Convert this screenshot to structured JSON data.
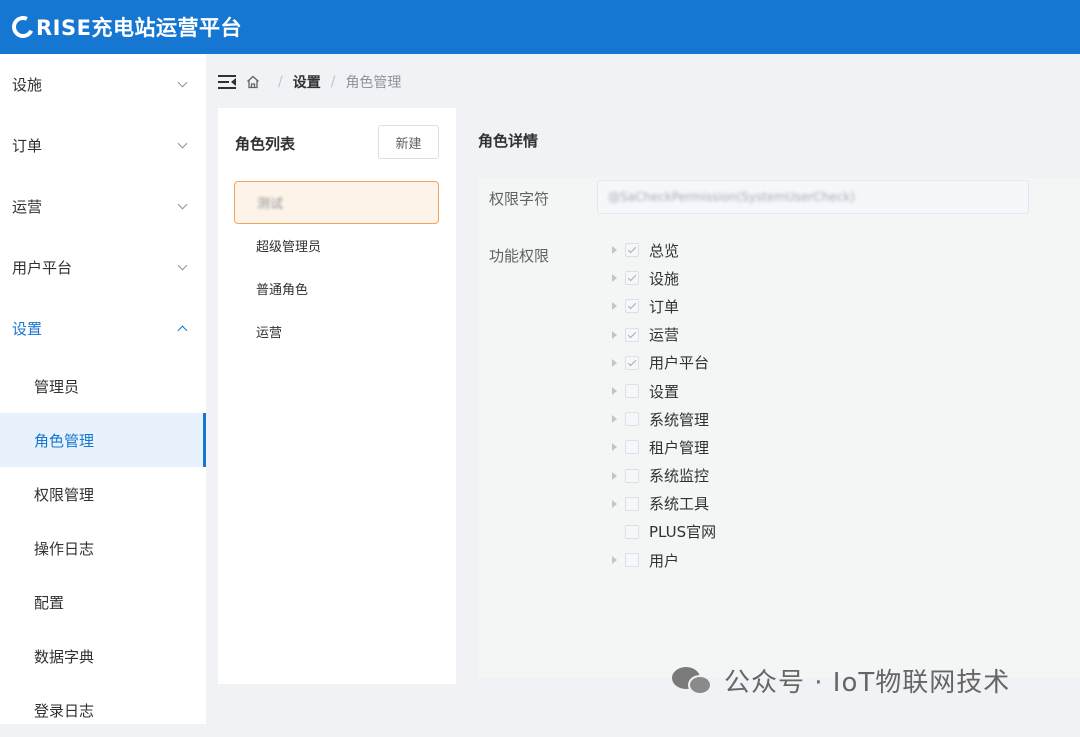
{
  "header": {
    "title": "RISE充电站运营平台"
  },
  "sidebar": {
    "menus": [
      {
        "label": "设施"
      },
      {
        "label": "订单"
      },
      {
        "label": "运营"
      },
      {
        "label": "用户平台"
      },
      {
        "label": "设置"
      }
    ],
    "sub_items": [
      {
        "label": "管理员"
      },
      {
        "label": "角色管理"
      },
      {
        "label": "权限管理"
      },
      {
        "label": "操作日志"
      },
      {
        "label": "配置"
      },
      {
        "label": "数据字典"
      },
      {
        "label": "登录日志"
      }
    ]
  },
  "breadcrumb": {
    "parent": "设置",
    "current": "角色管理",
    "separator": "/"
  },
  "role_list": {
    "title": "角色列表",
    "new_button": "新建",
    "roles": [
      {
        "label": "测试"
      },
      {
        "label": "超级管理员"
      },
      {
        "label": "普通角色"
      },
      {
        "label": "运营"
      }
    ]
  },
  "role_detail": {
    "title": "角色详情",
    "perm_label": "权限字符",
    "perm_value": "@SaCheckPermission(SystemUserCheck)",
    "func_label": "功能权限",
    "tree": [
      {
        "label": "总览",
        "checked": true,
        "has_children": true
      },
      {
        "label": "设施",
        "checked": true,
        "has_children": true
      },
      {
        "label": "订单",
        "checked": true,
        "has_children": true
      },
      {
        "label": "运营",
        "checked": true,
        "has_children": true
      },
      {
        "label": "用户平台",
        "checked": true,
        "has_children": true
      },
      {
        "label": "设置",
        "checked": false,
        "has_children": true
      },
      {
        "label": "系统管理",
        "checked": false,
        "has_children": true
      },
      {
        "label": "租户管理",
        "checked": false,
        "has_children": true
      },
      {
        "label": "系统监控",
        "checked": false,
        "has_children": true
      },
      {
        "label": "系统工具",
        "checked": false,
        "has_children": true
      },
      {
        "label": "PLUS官网",
        "checked": false,
        "has_children": false
      },
      {
        "label": "用户",
        "checked": false,
        "has_children": true
      }
    ]
  },
  "watermark": {
    "text": "公众号 · IoT物联网技术"
  },
  "colors": {
    "primary": "#1677d2",
    "selected_bg": "#fdf3e8",
    "selected_border": "#f0a55c"
  }
}
